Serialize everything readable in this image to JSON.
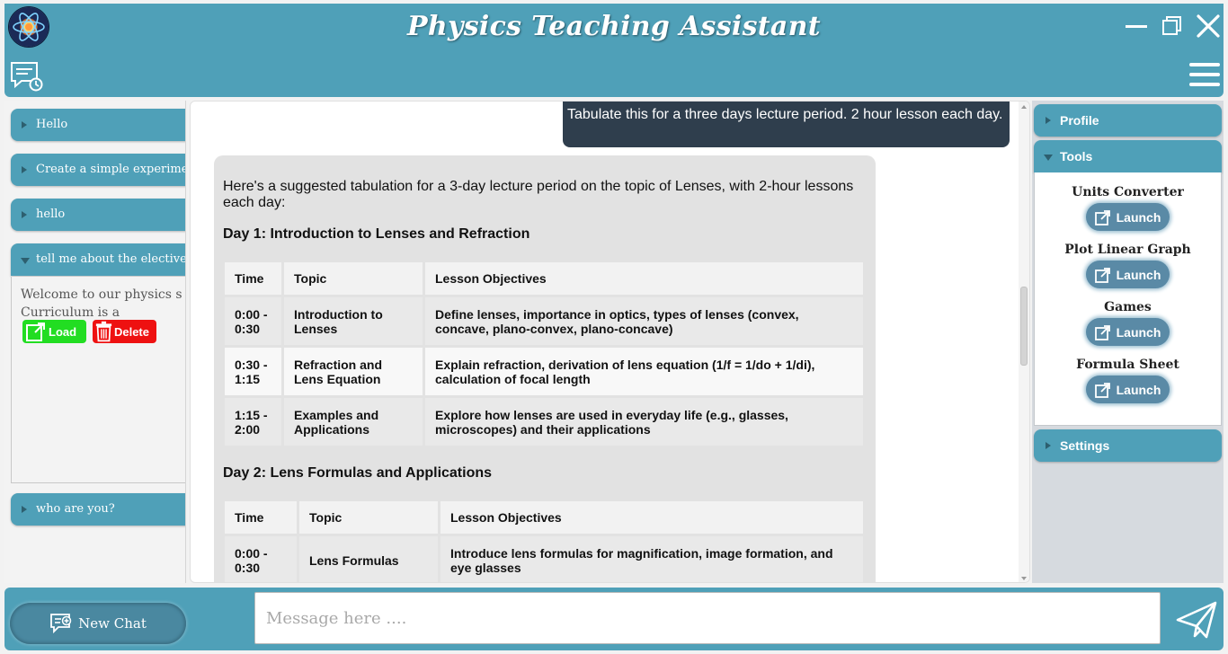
{
  "app": {
    "title": "Physics Teaching Assistant"
  },
  "sidebar": {
    "items": [
      {
        "label": "Hello"
      },
      {
        "label": "Create a simple experiment"
      },
      {
        "label": "hello"
      },
      {
        "label": "tell me about the elective"
      },
      {
        "label": "who are you?"
      }
    ],
    "expanded": {
      "preview_line1": "Welcome to our physics s",
      "preview_line2": "Curriculum is a",
      "load_label": "Load",
      "delete_label": "Delete"
    }
  },
  "chat": {
    "user_message": "Tabulate this for a three days lecture period. 2 hour lesson each day.",
    "bot_intro": "Here's a suggested tabulation for a 3-day lecture period on the topic of Lenses, with 2-hour lessons each day:",
    "columns": [
      "Time",
      "Topic",
      "Lesson Objectives"
    ],
    "days": [
      {
        "title": "Day 1: Introduction to Lenses and Refraction",
        "rows": [
          {
            "time": "0:00 - 0:30",
            "topic": "Introduction to Lenses",
            "objectives": "Define lenses, importance in optics, types of lenses (convex, concave, plano-convex, plano-concave)"
          },
          {
            "time": "0:30 - 1:15",
            "topic": "Refraction and Lens Equation",
            "objectives": "Explain refraction, derivation of lens equation (1/f = 1/do + 1/di), calculation of focal length"
          },
          {
            "time": "1:15 - 2:00",
            "topic": "Examples and Applications",
            "objectives": "Explore how lenses are used in everyday life (e.g., glasses, microscopes) and their applications"
          }
        ]
      },
      {
        "title": "Day 2: Lens Formulas and Applications",
        "rows": [
          {
            "time": "0:00 - 0:30",
            "topic": "Lens Formulas",
            "objectives": "Introduce lens formulas for magnification, image formation, and eye glasses"
          }
        ]
      }
    ]
  },
  "right_panel": {
    "profile_label": "Profile",
    "tools_label": "Tools",
    "settings_label": "Settings",
    "tools": [
      {
        "name": "Units Converter",
        "button": "Launch"
      },
      {
        "name": "Plot Linear Graph",
        "button": "Launch"
      },
      {
        "name": "Games",
        "button": "Launch"
      },
      {
        "name": "Formula Sheet",
        "button": "Launch"
      }
    ]
  },
  "bottom": {
    "new_chat_label": "New Chat",
    "message_placeholder": "Message here ...."
  },
  "colors": {
    "accent": "#4fa0b8",
    "user_bubble": "#2f3e4d",
    "load": "#22dd22",
    "delete": "#ee1111"
  }
}
